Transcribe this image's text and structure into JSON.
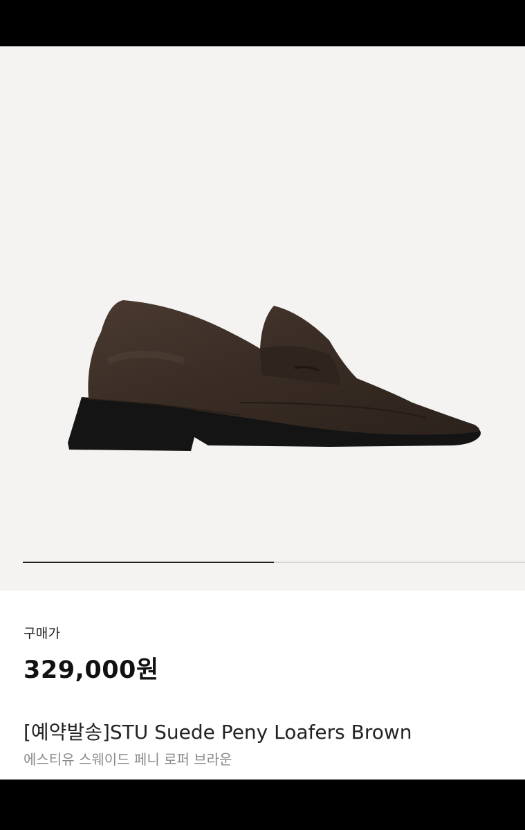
{
  "product": {
    "image_alt_icon": "loafer-shoe-image",
    "image_index_fraction": 0.5,
    "price_label": "구매가",
    "price": "329,000원",
    "title": "[예약발송]STU Suede Peny Loafers Brown",
    "subtitle": "에스티유 스웨이드 페니 로퍼 브라운"
  },
  "colors": {
    "image_background": "#f4f3f1",
    "shoe_brown": "#3a2d25",
    "sole_black": "#141414"
  }
}
